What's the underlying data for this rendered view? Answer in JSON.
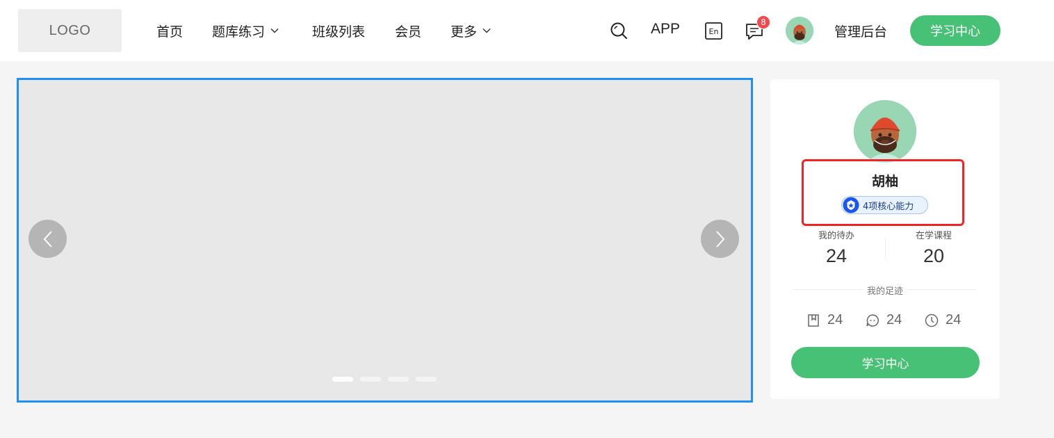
{
  "header": {
    "logo": "LOGO",
    "nav": [
      {
        "label": "首页"
      },
      {
        "label": "题库练习"
      },
      {
        "label": "班级列表"
      },
      {
        "label": "会员"
      },
      {
        "label": "更多"
      }
    ],
    "app_label": "APP",
    "message_badge": "8",
    "admin_label": "管理后台",
    "study_center_label": "学习中心"
  },
  "banner": {
    "slide_count": 4,
    "active_slide": 1
  },
  "profile": {
    "name": "胡柚",
    "ability_tag": "4项核心能力",
    "todo_label": "我的待办",
    "todo_count": "24",
    "courses_label": "在学课程",
    "courses_count": "20",
    "footprint_label": "我的足迹",
    "footprints": [
      {
        "icon": "bookmark-icon",
        "value": "24"
      },
      {
        "icon": "comment-icon",
        "value": "24"
      },
      {
        "icon": "clock-icon",
        "value": "24"
      }
    ],
    "study_center_label": "学习中心"
  },
  "colors": {
    "accent_green": "#47c176",
    "banner_border": "#1e90f5",
    "highlight_red": "#f02424",
    "badge_red": "#f5484a"
  }
}
